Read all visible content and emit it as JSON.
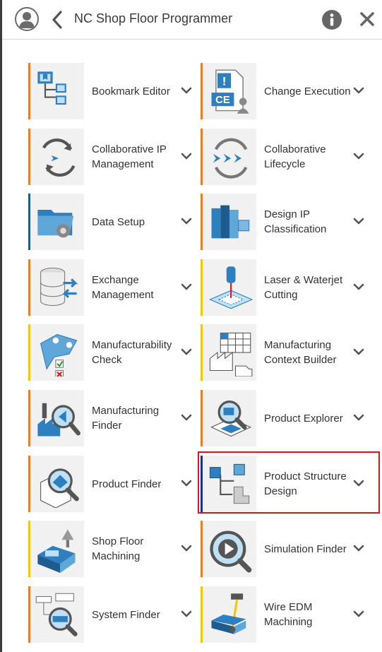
{
  "header": {
    "title": "NC Shop Floor Programmer",
    "avatar_icon": "user-avatar-icon",
    "back_icon": "chevron-left-icon",
    "info_icon": "info-icon",
    "close_icon": "close-icon"
  },
  "apps": [
    {
      "label": "Bookmark Editor",
      "stripe": "#e87d2a",
      "icon": "bookmark-editor-icon"
    },
    {
      "label": "Change Execution",
      "stripe": "#e87d2a",
      "icon": "change-execution-icon"
    },
    {
      "label": "Collaborative IP Management",
      "stripe": "#e87d2a",
      "icon": "collaborative-ip-icon"
    },
    {
      "label": "Collaborative Lifecycle",
      "stripe": "#e87d2a",
      "icon": "collaborative-lifecycle-icon"
    },
    {
      "label": "Data Setup",
      "stripe": "#1e5b8f",
      "icon": "data-setup-icon"
    },
    {
      "label": "Design IP Classification",
      "stripe": "#e87d2a",
      "icon": "design-ip-classification-icon"
    },
    {
      "label": "Exchange Management",
      "stripe": "#e87d2a",
      "icon": "exchange-management-icon"
    },
    {
      "label": "Laser & Waterjet Cutting",
      "stripe": "#f2c80f",
      "icon": "laser-waterjet-icon"
    },
    {
      "label": "Manufacturability Check",
      "stripe": "#f2c80f",
      "icon": "manufacturability-check-icon"
    },
    {
      "label": "Manufacturing Context Builder",
      "stripe": "#f2c80f",
      "icon": "manufacturing-context-builder-icon"
    },
    {
      "label": "Manufacturing Finder",
      "stripe": "#e87d2a",
      "icon": "manufacturing-finder-icon"
    },
    {
      "label": "Product Explorer",
      "stripe": "#e87d2a",
      "icon": "product-explorer-icon"
    },
    {
      "label": "Product Finder",
      "stripe": "#e87d2a",
      "icon": "product-finder-icon"
    },
    {
      "label": "Product Structure Design",
      "stripe": "#1e2f8f",
      "icon": "product-structure-design-icon",
      "selected": true
    },
    {
      "label": "Shop Floor Machining",
      "stripe": "#f2c80f",
      "icon": "shop-floor-machining-icon"
    },
    {
      "label": "Simulation Finder",
      "stripe": "#e87d2a",
      "icon": "simulation-finder-icon"
    },
    {
      "label": "System Finder",
      "stripe": "#e87d2a",
      "icon": "system-finder-icon"
    },
    {
      "label": "Wire EDM Machining",
      "stripe": "#f2c80f",
      "icon": "wire-edm-icon"
    }
  ],
  "colors": {
    "selection": "#e0141c",
    "accent_blue": "#2e7fbf",
    "accent_light_blue": "#7fb6de"
  }
}
